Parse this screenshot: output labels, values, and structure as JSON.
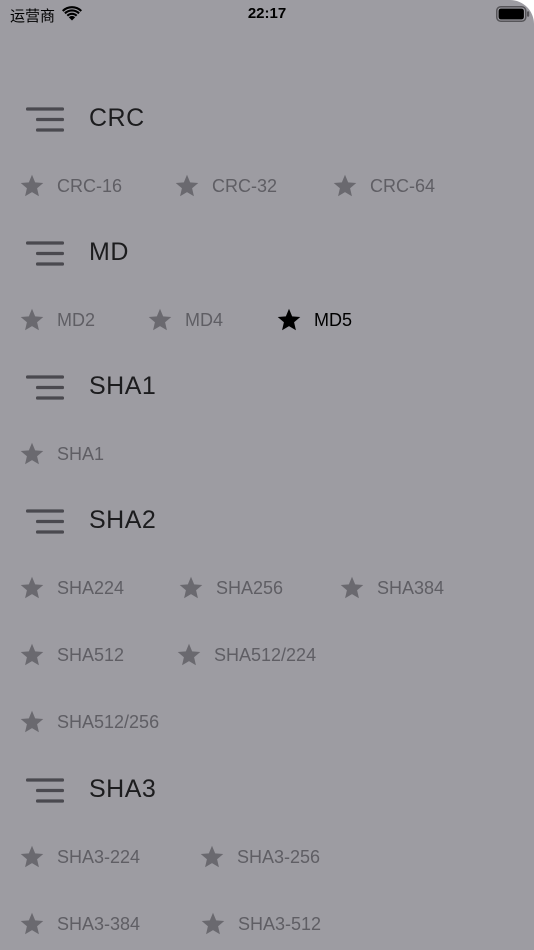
{
  "status_bar": {
    "carrier": "运营商",
    "time": "22:17"
  },
  "colors": {
    "background": "#9d9ca2",
    "title": "#1c1c1e",
    "item_text": "#5f5e64",
    "item_icon": "#6a696f",
    "selected": "#000000",
    "menu_icon": "#4a494f"
  },
  "sections": [
    {
      "title": "CRC",
      "items": [
        {
          "label": "CRC-16",
          "selected": false
        },
        {
          "label": "CRC-32",
          "selected": false
        },
        {
          "label": "CRC-64",
          "selected": false
        }
      ]
    },
    {
      "title": "MD",
      "items": [
        {
          "label": "MD2",
          "selected": false
        },
        {
          "label": "MD4",
          "selected": false
        },
        {
          "label": "MD5",
          "selected": true
        }
      ]
    },
    {
      "title": "SHA1",
      "items": [
        {
          "label": "SHA1",
          "selected": false
        }
      ]
    },
    {
      "title": "SHA2",
      "items": [
        {
          "label": "SHA224",
          "selected": false
        },
        {
          "label": "SHA256",
          "selected": false
        },
        {
          "label": "SHA384",
          "selected": false
        },
        {
          "label": "SHA512",
          "selected": false
        },
        {
          "label": "SHA512/224",
          "selected": false
        },
        {
          "label": "SHA512/256",
          "selected": false
        }
      ]
    },
    {
      "title": "SHA3",
      "items": [
        {
          "label": "SHA3-224",
          "selected": false
        },
        {
          "label": "SHA3-256",
          "selected": false
        },
        {
          "label": "SHA3-384",
          "selected": false
        },
        {
          "label": "SHA3-512",
          "selected": false
        }
      ]
    }
  ]
}
